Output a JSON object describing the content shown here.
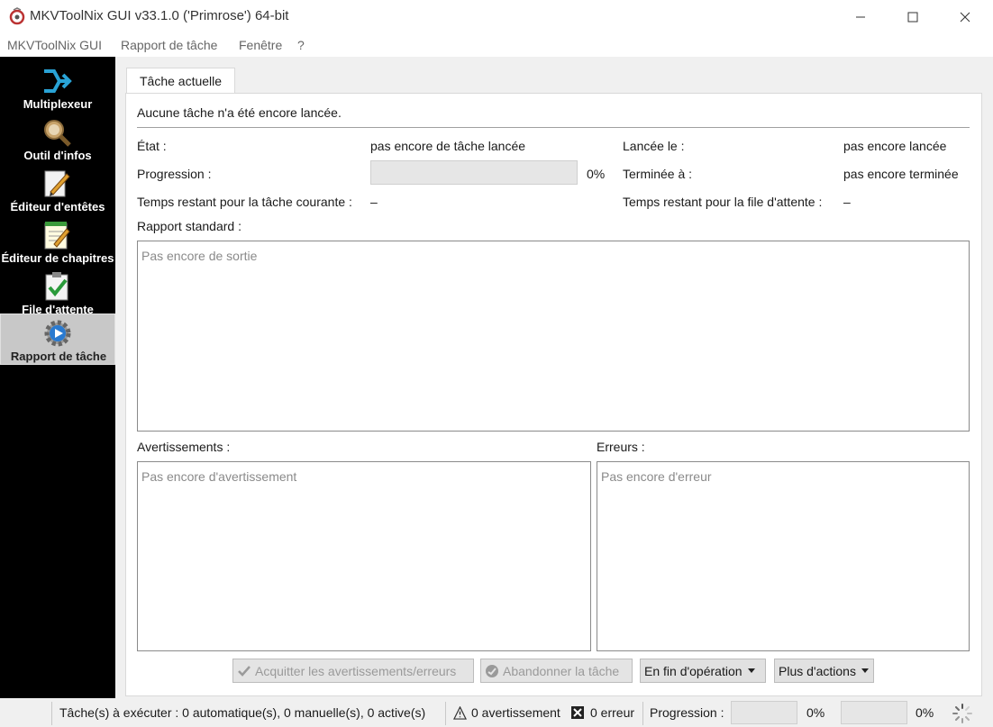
{
  "window": {
    "title": "MKVToolNix GUI v33.1.0 ('Primrose') 64-bit",
    "minimize_icon": "minimize-icon",
    "maximize_icon": "maximize-icon",
    "close_icon": "close-icon"
  },
  "menu": [
    "MKVToolNix GUI",
    "Rapport de tâche",
    "Fenêtre",
    "?"
  ],
  "sidebar": {
    "items": [
      {
        "label": "Multiplexeur",
        "icon": "merge-arrows-icon"
      },
      {
        "label": "Outil d'infos",
        "icon": "magnifier-icon"
      },
      {
        "label": "Éditeur d'entêtes",
        "icon": "pencil-icon"
      },
      {
        "label": "Éditeur de chapitres",
        "icon": "notepad-icon"
      },
      {
        "label": "File d'attente",
        "icon": "checklist-icon"
      },
      {
        "label": "Rapport de tâche",
        "icon": "gear-play-icon",
        "active": true
      }
    ]
  },
  "tab": {
    "label": "Tâche actuelle"
  },
  "job": {
    "no_job_text": "Aucune tâche n'a été encore lancée.",
    "state_label": "État :",
    "state_value": "pas encore de tâche lancée",
    "started_label": "Lancée le :",
    "started_value": "pas encore lancée",
    "progress_label": "Progression :",
    "progress_value": 0,
    "progress_percent": "0%",
    "finished_label": "Terminée à :",
    "finished_value": "pas encore terminée",
    "remaining_current_label": "Temps restant pour la tâche courante :",
    "remaining_current_value": "–",
    "remaining_queue_label": "Temps restant pour la file d'attente :",
    "remaining_queue_value": "–",
    "standard_output_label": "Rapport standard :",
    "standard_output_placeholder": "Pas encore de sortie",
    "warnings_label": "Avertissements :",
    "warnings_placeholder": "Pas encore d'avertissement",
    "errors_label": "Erreurs :",
    "errors_placeholder": "Pas encore d'erreur"
  },
  "buttons": {
    "acknowledge": "Acquitter les avertissements/erreurs",
    "abort": "Abandonner la tâche",
    "on_finish": "En fin d'opération",
    "more_actions": "Plus d'actions"
  },
  "status": {
    "jobs_to_run": "Tâche(s) à exécuter : 0 automatique(s), 0 manuelle(s), 0 active(s)",
    "warnings": "0 avertissement",
    "errors": "0 erreur",
    "progress_label": "Progression :",
    "progress_current": "0%",
    "progress_total": "0%"
  }
}
